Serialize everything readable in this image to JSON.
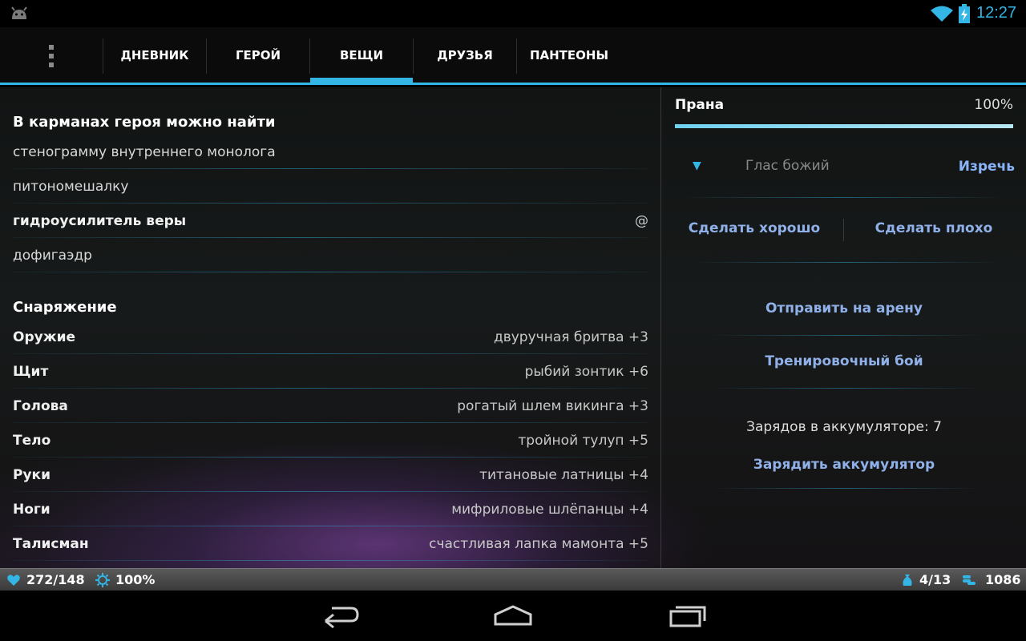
{
  "status_bar": {
    "time": "12:27",
    "icons": [
      "android-icon",
      "wifi-icon",
      "battery-charging-icon"
    ]
  },
  "tabs": [
    {
      "label": "ДНЕВНИК",
      "active": false
    },
    {
      "label": "ГЕРОЙ",
      "active": false
    },
    {
      "label": "ВЕЩИ",
      "active": true
    },
    {
      "label": "ДРУЗЬЯ",
      "active": false
    },
    {
      "label": "ПАНТЕОНЫ",
      "active": false
    }
  ],
  "inventory": {
    "title": "В карманах героя можно найти",
    "items": [
      {
        "name": "стенограмму внутреннего монолога",
        "mark": "",
        "bold": false
      },
      {
        "name": "питономешалку",
        "mark": "",
        "bold": false
      },
      {
        "name": "гидроусилитель веры",
        "mark": "@",
        "bold": true
      },
      {
        "name": "дофигаэдр",
        "mark": "",
        "bold": false
      }
    ]
  },
  "equipment": {
    "title": "Снаряжение",
    "items": [
      {
        "slot": "Оружие",
        "value": "двуручная бритва +3"
      },
      {
        "slot": "Щит",
        "value": "рыбий зонтик +6"
      },
      {
        "slot": "Голова",
        "value": "рогатый шлем викинга +3"
      },
      {
        "slot": "Тело",
        "value": "тройной тулуп +5"
      },
      {
        "slot": "Руки",
        "value": "титановые латницы +4"
      },
      {
        "slot": "Ноги",
        "value": "мифриловые шлёпанцы +4"
      },
      {
        "slot": "Талисман",
        "value": "счастливая лапка мамонта +5"
      }
    ]
  },
  "right": {
    "prana_label": "Прана",
    "prana_value": "100%",
    "prana_fraction": 1.0,
    "voice_placeholder": "Глас божий",
    "voice_button": "Изречь",
    "good_button": "Сделать хорошо",
    "bad_button": "Сделать плохо",
    "arena_button": "Отправить на арену",
    "training_button": "Тренировочный бой",
    "charges_text": "Зарядов в аккумуляторе: 7",
    "charge_button": "Зарядить аккумулятор"
  },
  "info_bar": {
    "health": "272/148",
    "prana": "100%",
    "inventory": "4/13",
    "gold": "1086",
    "colors": {
      "health_icon": "#33b5e5",
      "accent": "#33b5e5"
    }
  },
  "nav_bar": {
    "buttons": [
      "back-icon",
      "home-icon",
      "recents-icon"
    ]
  }
}
